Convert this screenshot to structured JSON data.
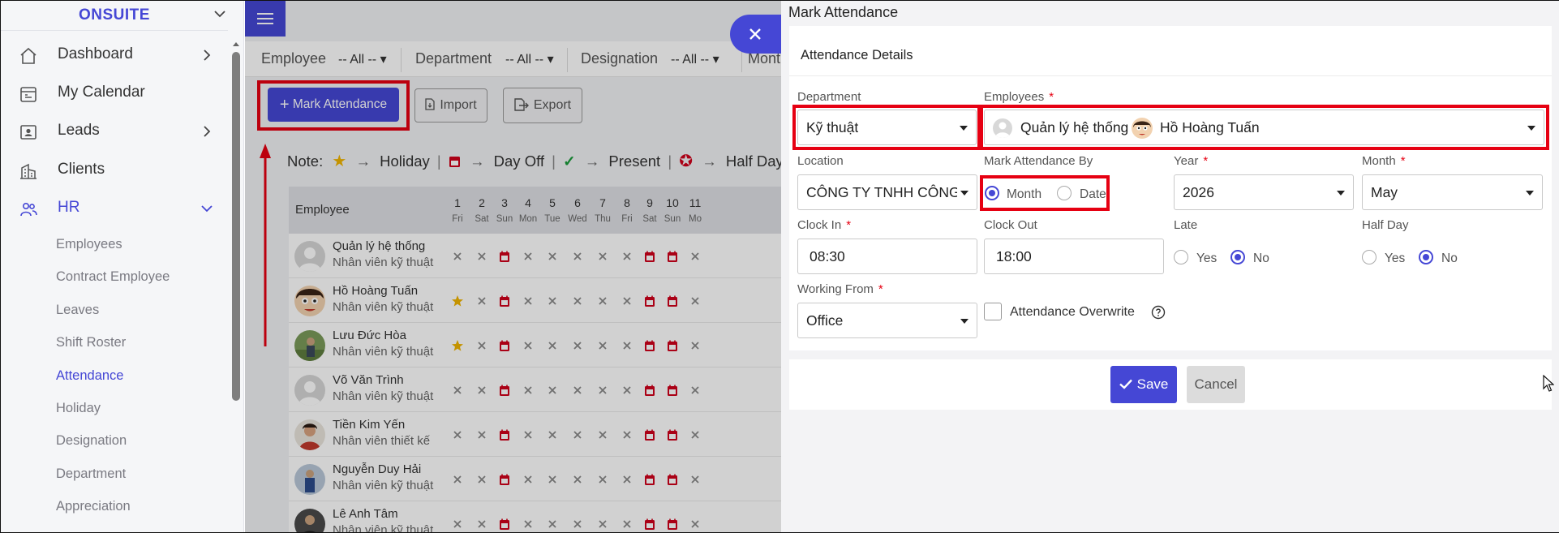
{
  "sidebar": {
    "brand": "ONSUITE",
    "items": [
      {
        "label": "Dashboard",
        "icon": "home-icon"
      },
      {
        "label": "My Calendar",
        "icon": "calendar-icon"
      },
      {
        "label": "Leads",
        "icon": "contact-card-icon"
      },
      {
        "label": "Clients",
        "icon": "building-icon"
      },
      {
        "label": "HR",
        "icon": "users-icon"
      }
    ],
    "hr_sub": [
      "Employees",
      "Contract Employee",
      "Leaves",
      "Shift Roster",
      "Attendance",
      "Holiday",
      "Designation",
      "Department",
      "Appreciation"
    ],
    "active_sub": "Attendance",
    "accent": "#4547d5"
  },
  "filters": {
    "employee_label": "Employee",
    "employee_value": "-- All --",
    "department_label": "Department",
    "department_value": "-- All --",
    "designation_label": "Designation",
    "designation_value": "-- All --",
    "month_label": "Mont"
  },
  "toolbar": {
    "mark_attendance": "Mark Attendance",
    "import": "Import",
    "export": "Export"
  },
  "note": {
    "prefix": "Note:",
    "holiday": "Holiday",
    "day_off": "Day Off",
    "present": "Present",
    "half_day": "Half Day"
  },
  "table": {
    "header": "Employee",
    "days": [
      {
        "d": "1",
        "w": "Fri"
      },
      {
        "d": "2",
        "w": "Sat"
      },
      {
        "d": "3",
        "w": "Sun"
      },
      {
        "d": "4",
        "w": "Mon"
      },
      {
        "d": "5",
        "w": "Tue"
      },
      {
        "d": "6",
        "w": "Wed"
      },
      {
        "d": "7",
        "w": "Thu"
      },
      {
        "d": "8",
        "w": "Fri"
      },
      {
        "d": "9",
        "w": "Sat"
      },
      {
        "d": "10",
        "w": "Sun"
      },
      {
        "d": "11",
        "w": "Mo"
      }
    ],
    "rows": [
      {
        "name": "Quản lý hệ thống",
        "role": "Nhân viên kỹ thuật",
        "avatar": "default",
        "marks": [
          "x",
          "x",
          "cal",
          "x",
          "x",
          "x",
          "x",
          "x",
          "cal",
          "cal",
          "x"
        ]
      },
      {
        "name": "Hồ Hoàng Tuấn",
        "role": "Nhân viên kỹ thuật",
        "avatar": "cartoon",
        "marks": [
          "star",
          "x",
          "cal",
          "x",
          "x",
          "x",
          "x",
          "x",
          "cal",
          "cal",
          "x"
        ]
      },
      {
        "name": "Lưu Đức Hòa",
        "role": "Nhân viên kỹ thuật",
        "avatar": "photo-green",
        "marks": [
          "star",
          "x",
          "cal",
          "x",
          "x",
          "x",
          "x",
          "x",
          "cal",
          "cal",
          "x"
        ]
      },
      {
        "name": "Võ Văn Trình",
        "role": "Nhân viên kỹ thuật",
        "avatar": "default",
        "marks": [
          "x",
          "x",
          "cal",
          "x",
          "x",
          "x",
          "x",
          "x",
          "cal",
          "cal",
          "x"
        ]
      },
      {
        "name": "Tiền Kim Yến",
        "role": "Nhân viên thiết kế",
        "avatar": "photo-red",
        "marks": [
          "x",
          "x",
          "cal",
          "x",
          "x",
          "x",
          "x",
          "x",
          "cal",
          "cal",
          "x"
        ]
      },
      {
        "name": "Nguyễn Duy Hải",
        "role": "Nhân viên kỹ thuật",
        "avatar": "photo-blue",
        "marks": [
          "x",
          "x",
          "cal",
          "x",
          "x",
          "x",
          "x",
          "x",
          "cal",
          "cal",
          "x"
        ]
      },
      {
        "name": "Lê Anh Tâm",
        "role": "Nhân viên kỹ thuật",
        "avatar": "photo-dark",
        "marks": [
          "x",
          "x",
          "cal",
          "x",
          "x",
          "x",
          "x",
          "x",
          "cal",
          "cal",
          "x"
        ]
      }
    ]
  },
  "panel": {
    "title": "Mark Attendance",
    "section": "Attendance Details",
    "department": {
      "label": "Department",
      "value": "Kỹ thuật"
    },
    "employees": {
      "label": "Employees",
      "required": "*",
      "chip1": "Quản lý hệ thống",
      "chip2": "Hồ Hoàng Tuấn"
    },
    "location": {
      "label": "Location",
      "value": "CÔNG TY TNHH CÔNG"
    },
    "mark_by": {
      "label": "Mark Attendance By",
      "opt_month": "Month",
      "opt_date": "Date",
      "selected": "Month"
    },
    "year": {
      "label": "Year",
      "required": "*",
      "value": "2026"
    },
    "month": {
      "label": "Month",
      "required": "*",
      "value": "May"
    },
    "clock_in": {
      "label": "Clock In",
      "required": "*",
      "value": "08:30"
    },
    "clock_out": {
      "label": "Clock Out",
      "value": "18:00"
    },
    "late": {
      "label": "Late",
      "yes": "Yes",
      "no": "No",
      "selected": "No"
    },
    "half_day": {
      "label": "Half Day",
      "yes": "Yes",
      "no": "No",
      "selected": "No"
    },
    "working_from": {
      "label": "Working From",
      "required": "*",
      "value": "Office"
    },
    "overwrite": {
      "label": "Attendance Overwrite",
      "checked": false
    },
    "save": "Save",
    "cancel": "Cancel"
  }
}
